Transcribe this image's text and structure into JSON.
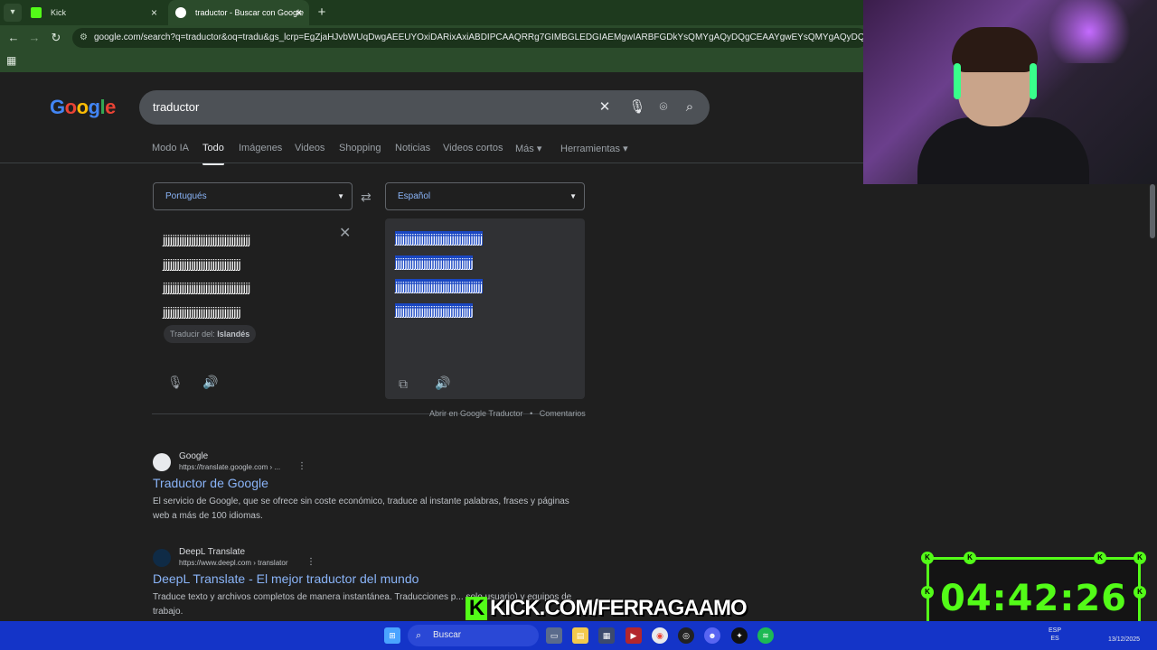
{
  "browser": {
    "tabs": [
      {
        "label": "Kick"
      },
      {
        "label": "traductor - Buscar con Google"
      }
    ],
    "url": "google.com/search?q=traductor&oq=tradu&gs_lcrp=EgZjaHJvbWUqDwgAEEUYOxiDARixAxiABDIPCAAQRRg7GIMBGLEDGIAEMgwIARBFGDkYsQMYgAQyDQgCEAAYgwEYsQMYgAQyDQgDEAAYgwEYsQMYgAQ"
  },
  "google": {
    "query": "traductor",
    "tabs": [
      "Modo IA",
      "Todo",
      "Imágenes",
      "Videos",
      "Shopping",
      "Noticias",
      "Videos cortos",
      "Más",
      "Herramientas"
    ],
    "active_tab": "Todo"
  },
  "translator": {
    "source_lang": "Portugués",
    "target_lang": "Español",
    "source_lines": [
      "jjjjjjjjjjjjjjjjjjjjjjjjjjjjjjjjjjjjj",
      "jjjjjjjjjjjjjjjjjjjjjjjjjjjjjjjjj",
      "jjjjjjjjjjjjjjjjjjjjjjjjjjjjjjjjjjjjj",
      "jjjjjjjjjjjjjjjjjjjjjjjjjjjjjjjjj"
    ],
    "target_lines": [
      "jjjjjjjjjjjjjjjjjjjjjjjjjjjjjjjjjjjjj",
      "jjjjjjjjjjjjjjjjjjjjjjjjjjjjjjjjj",
      "jjjjjjjjjjjjjjjjjjjjjjjjjjjjjjjjjjjjj",
      "jjjjjjjjjjjjjjjjjjjjjjjjjjjjjjjjj"
    ],
    "detect_prefix": "Traducir del: ",
    "detect_lang": "Islandés",
    "open_link": "Abrir en Google Traductor",
    "separator": "•",
    "feedback_link": "Comentarios"
  },
  "results": [
    {
      "site": "Google",
      "url": "https://translate.google.com › ...",
      "title": "Traductor de Google",
      "desc": "El servicio de Google, que se ofrece sin coste económico, traduce al instante palabras, frases y páginas web a más de 100 idiomas."
    },
    {
      "site": "DeepL Translate",
      "url": "https://www.deepl.com › translator",
      "title": "DeepL Translate - El mejor traductor del mundo",
      "desc": "Traduce texto y archivos completos de manera instantánea. Traducciones p... solo usuario) y equipos de trabajo."
    }
  ],
  "overlay": {
    "kick_text": "KICK.COM/FERRAGAAMO",
    "timer": "04:42:26"
  },
  "taskbar": {
    "search_label": "Buscar",
    "lang": "ESP",
    "lang_sub": "ES",
    "date": "13/12/2025"
  },
  "colors": {
    "kick_green": "#53fc18",
    "link_blue": "#8ab4f8",
    "taskbar_blue": "#1434c8",
    "selection": "#1a47c2"
  }
}
